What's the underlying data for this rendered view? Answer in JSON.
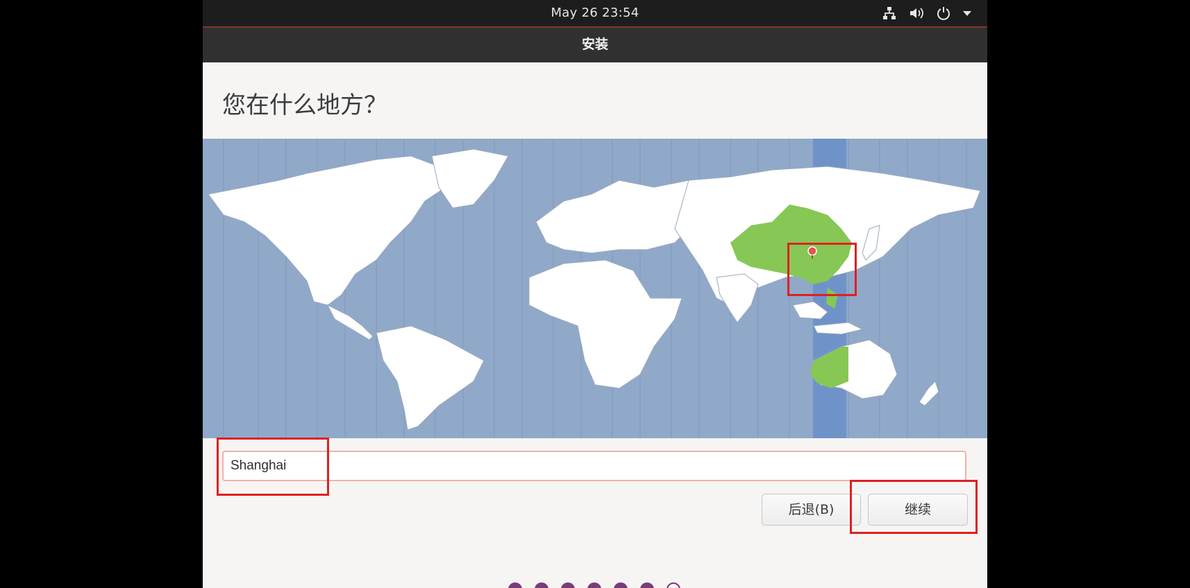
{
  "topbar": {
    "clock": "May 26  23:54",
    "tray_icons": [
      "network-icon",
      "volume-icon",
      "power-icon",
      "menu-arrow-icon"
    ]
  },
  "window": {
    "title": "安装"
  },
  "page": {
    "question": "您在什么地方？"
  },
  "location": {
    "value": "Shanghai",
    "selected_timezone_region": "China"
  },
  "buttons": {
    "back": "后退(B)",
    "next": "继续"
  },
  "progress": {
    "total_steps": 7,
    "completed_steps": 6
  },
  "colors": {
    "accent_highlight": "#e02020",
    "map_ocean": "#90a9c9",
    "map_land": "#ffffff",
    "map_selected": "#87c756",
    "timezone_band": "#6f93c8",
    "progress_dot": "#7a3b7a"
  }
}
